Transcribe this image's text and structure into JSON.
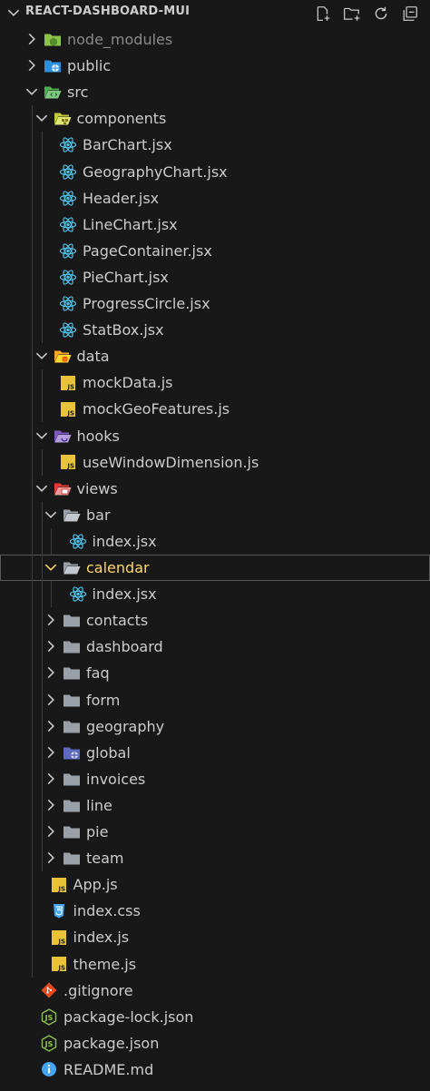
{
  "explorer": {
    "title": "REACT-DASHBOARD-MUI",
    "actions": [
      "new-file-icon",
      "new-folder-icon",
      "refresh-icon",
      "collapse-all-icon"
    ]
  },
  "tree": [
    {
      "label": "node_modules",
      "type": "folder",
      "icon": "node",
      "depth": 0,
      "expanded": false,
      "dim": true
    },
    {
      "label": "public",
      "type": "folder",
      "icon": "public",
      "depth": 0,
      "expanded": false
    },
    {
      "label": "src",
      "type": "folder",
      "icon": "src",
      "depth": 0,
      "expanded": true
    },
    {
      "label": "components",
      "type": "folder",
      "icon": "components",
      "depth": 1,
      "expanded": true
    },
    {
      "label": "BarChart.jsx",
      "type": "file",
      "icon": "react",
      "depth": 2
    },
    {
      "label": "GeographyChart.jsx",
      "type": "file",
      "icon": "react",
      "depth": 2
    },
    {
      "label": "Header.jsx",
      "type": "file",
      "icon": "react",
      "depth": 2
    },
    {
      "label": "LineChart.jsx",
      "type": "file",
      "icon": "react",
      "depth": 2
    },
    {
      "label": "PageContainer.jsx",
      "type": "file",
      "icon": "react",
      "depth": 2
    },
    {
      "label": "PieChart.jsx",
      "type": "file",
      "icon": "react",
      "depth": 2
    },
    {
      "label": "ProgressCircle.jsx",
      "type": "file",
      "icon": "react",
      "depth": 2
    },
    {
      "label": "StatBox.jsx",
      "type": "file",
      "icon": "react",
      "depth": 2
    },
    {
      "label": "data",
      "type": "folder",
      "icon": "data",
      "depth": 1,
      "expanded": true
    },
    {
      "label": "mockData.js",
      "type": "file",
      "icon": "js",
      "depth": 2
    },
    {
      "label": "mockGeoFeatures.js",
      "type": "file",
      "icon": "js",
      "depth": 2
    },
    {
      "label": "hooks",
      "type": "folder",
      "icon": "hooks",
      "depth": 1,
      "expanded": true
    },
    {
      "label": "useWindowDimension.js",
      "type": "file",
      "icon": "js",
      "depth": 2
    },
    {
      "label": "views",
      "type": "folder",
      "icon": "views",
      "depth": 1,
      "expanded": true
    },
    {
      "label": "bar",
      "type": "folder",
      "icon": "folder-open",
      "depth": 2,
      "expanded": true
    },
    {
      "label": "index.jsx",
      "type": "file",
      "icon": "react",
      "depth": 3
    },
    {
      "label": "calendar",
      "type": "folder",
      "icon": "folder-open",
      "depth": 2,
      "expanded": true,
      "selected": true
    },
    {
      "label": "index.jsx",
      "type": "file",
      "icon": "react",
      "depth": 3
    },
    {
      "label": "contacts",
      "type": "folder",
      "icon": "folder",
      "depth": 2,
      "expanded": false
    },
    {
      "label": "dashboard",
      "type": "folder",
      "icon": "folder",
      "depth": 2,
      "expanded": false
    },
    {
      "label": "faq",
      "type": "folder",
      "icon": "folder",
      "depth": 2,
      "expanded": false
    },
    {
      "label": "form",
      "type": "folder",
      "icon": "folder",
      "depth": 2,
      "expanded": false
    },
    {
      "label": "geography",
      "type": "folder",
      "icon": "folder",
      "depth": 2,
      "expanded": false
    },
    {
      "label": "global",
      "type": "folder",
      "icon": "global",
      "depth": 2,
      "expanded": false
    },
    {
      "label": "invoices",
      "type": "folder",
      "icon": "folder",
      "depth": 2,
      "expanded": false
    },
    {
      "label": "line",
      "type": "folder",
      "icon": "folder",
      "depth": 2,
      "expanded": false
    },
    {
      "label": "pie",
      "type": "folder",
      "icon": "folder",
      "depth": 2,
      "expanded": false
    },
    {
      "label": "team",
      "type": "folder",
      "icon": "folder",
      "depth": 2,
      "expanded": false
    },
    {
      "label": "App.js",
      "type": "file",
      "icon": "js",
      "depth": 1
    },
    {
      "label": "index.css",
      "type": "file",
      "icon": "css",
      "depth": 1
    },
    {
      "label": "index.js",
      "type": "file",
      "icon": "js",
      "depth": 1
    },
    {
      "label": "theme.js",
      "type": "file",
      "icon": "js",
      "depth": 1
    },
    {
      "label": ".gitignore",
      "type": "file",
      "icon": "git",
      "depth": 0
    },
    {
      "label": "package-lock.json",
      "type": "file",
      "icon": "nodejs",
      "depth": 0
    },
    {
      "label": "package.json",
      "type": "file",
      "icon": "nodejs",
      "depth": 0
    },
    {
      "label": "README.md",
      "type": "file",
      "icon": "info",
      "depth": 0
    }
  ],
  "colors": {
    "background": "#181818",
    "text": "#cccccc",
    "selected_text": "#ffd866",
    "react": "#4fc1e9",
    "js": "#e8c33a"
  }
}
